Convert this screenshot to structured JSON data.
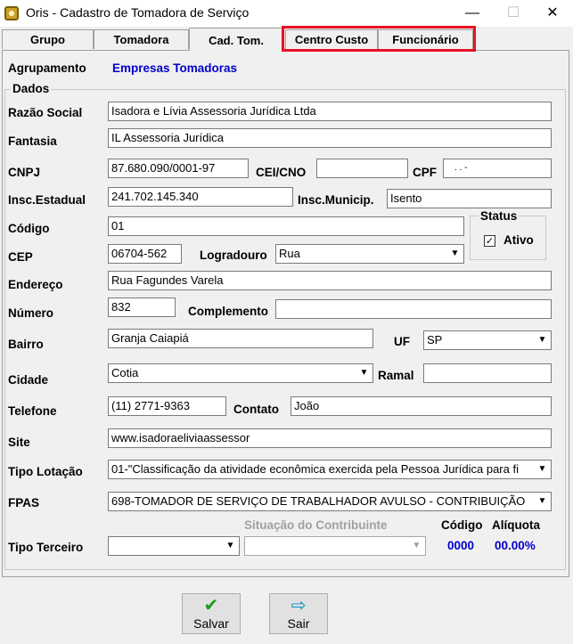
{
  "window": {
    "title": "Oris - Cadastro de Tomadora de Serviço",
    "minimize": "—",
    "maximize": "☐",
    "close": "✕"
  },
  "tabs": [
    "Grupo",
    "Tomadora",
    "Cad. Tom.",
    "Centro Custo",
    "Funcionário"
  ],
  "agrupamento": {
    "label": "Agrupamento",
    "value": "Empresas Tomadoras"
  },
  "dados": {
    "title": "Dados",
    "razao_social": {
      "label": "Razão Social",
      "value": "Isadora e Lívia Assessoria Jurídica Ltda"
    },
    "fantasia": {
      "label": "Fantasia",
      "value": "IL Assessoria Jurídica"
    },
    "cnpj": {
      "label": "CNPJ",
      "value": "87.680.090/0001-97"
    },
    "cei": {
      "label": "CEI/CNO",
      "value": ""
    },
    "cpf": {
      "label": "CPF",
      "value": ".   .   -"
    },
    "insc_estadual": {
      "label": "Insc.Estadual",
      "value": "241.702.145.340"
    },
    "insc_municip": {
      "label": "Insc.Municip.",
      "value": "Isento"
    },
    "codigo": {
      "label": "Código",
      "value": "01"
    },
    "status": {
      "title": "Status",
      "ativo_label": "Ativo",
      "ativo_checked": "✓"
    },
    "cep": {
      "label": "CEP",
      "value": "06704-562"
    },
    "logradouro": {
      "label": "Logradouro",
      "value": "Rua"
    },
    "endereco": {
      "label": "Endereço",
      "value": "Rua Fagundes Varela"
    },
    "numero": {
      "label": "Número",
      "value": "832"
    },
    "complemento": {
      "label": "Complemento",
      "value": ""
    },
    "bairro": {
      "label": "Bairro",
      "value": "Granja Caiapiá"
    },
    "uf": {
      "label": "UF",
      "value": "SP"
    },
    "cidade": {
      "label": "Cidade",
      "value": "Cotia"
    },
    "ramal": {
      "label": "Ramal",
      "value": ""
    },
    "telefone": {
      "label": "Telefone",
      "value": "(11) 2771-9363"
    },
    "contato": {
      "label": "Contato",
      "value": "João"
    },
    "site": {
      "label": "Site",
      "value": "www.isadoraeliviaassessor"
    },
    "tipo_lotacao": {
      "label": "Tipo Lotação",
      "value": "01-\"Classificação da atividade econômica exercida pela Pessoa Jurídica para fi"
    },
    "fpas": {
      "label": "FPAS",
      "value": "698-TOMADOR DE SERVIÇO DE TRABALHADOR AVULSO - CONTRIBUIÇÃO"
    },
    "situacao_contribuinte": {
      "label": "Situação do Contribuinte"
    },
    "codigo_header": "Código",
    "aliquota_header": "Alíquota",
    "codigo_value": "0000",
    "aliquota_value": "00.00%",
    "tipo_terceiro": {
      "label": "Tipo Terceiro",
      "value": ""
    }
  },
  "buttons": {
    "salvar": "Salvar",
    "sair": "Sair"
  },
  "icons": {
    "check": "✔",
    "arrow": "⇨",
    "dropdown": "▼"
  },
  "colors": {
    "accent_blue": "#0000cc",
    "highlight_red": "#e81123",
    "check_green": "#1a9a1a",
    "arrow_cyan": "#0090c0"
  }
}
